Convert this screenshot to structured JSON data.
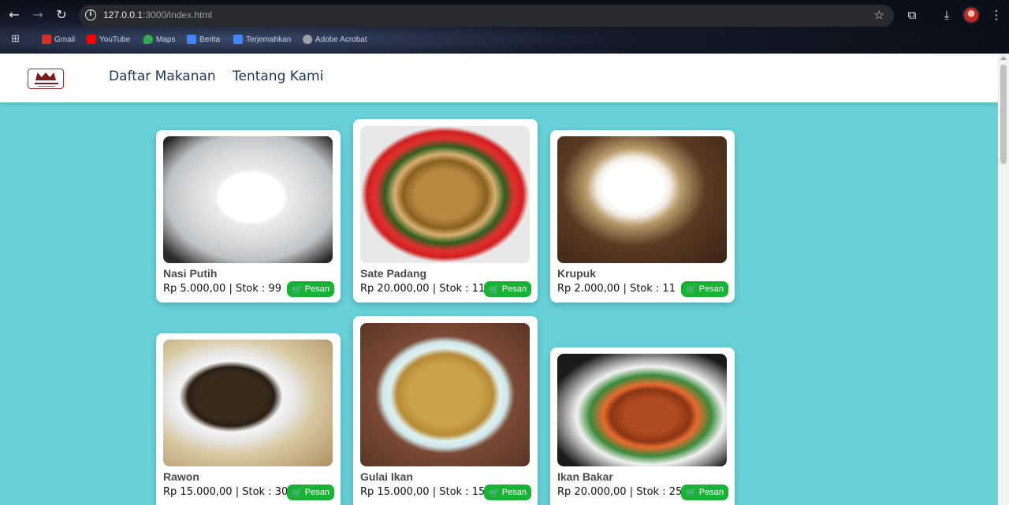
{
  "browser": {
    "url_host": "127.0.0.1",
    "url_rest": ":3000/index.html",
    "bookmarks": [
      "Gmail",
      "YouTube",
      "Maps",
      "Berita",
      "Terjemahkan",
      "Adobe Acrobat"
    ]
  },
  "header": {
    "nav": [
      "Daftar Makanan",
      "Tentang Kami"
    ]
  },
  "menu": {
    "button_label": "Pesan",
    "items": [
      {
        "name": "Nasi Putih",
        "info": "Rp 5.000,00 | Stok : 99"
      },
      {
        "name": "Sate Padang",
        "info": "Rp 20.000,00 | Stok : 11"
      },
      {
        "name": "Krupuk",
        "info": "Rp 2.000,00 | Stok : 11"
      },
      {
        "name": "Rawon",
        "info": "Rp 15.000,00 | Stok : 30"
      },
      {
        "name": "Gulai Ikan",
        "info": "Rp 15.000,00 | Stok : 15"
      },
      {
        "name": "Ikan Bakar",
        "info": "Rp 20.000,00 | Stok : 25"
      }
    ]
  },
  "colors": {
    "page_bg": "#67d0d8",
    "order_button": "#17b334",
    "nav_text": "#1d3557"
  }
}
